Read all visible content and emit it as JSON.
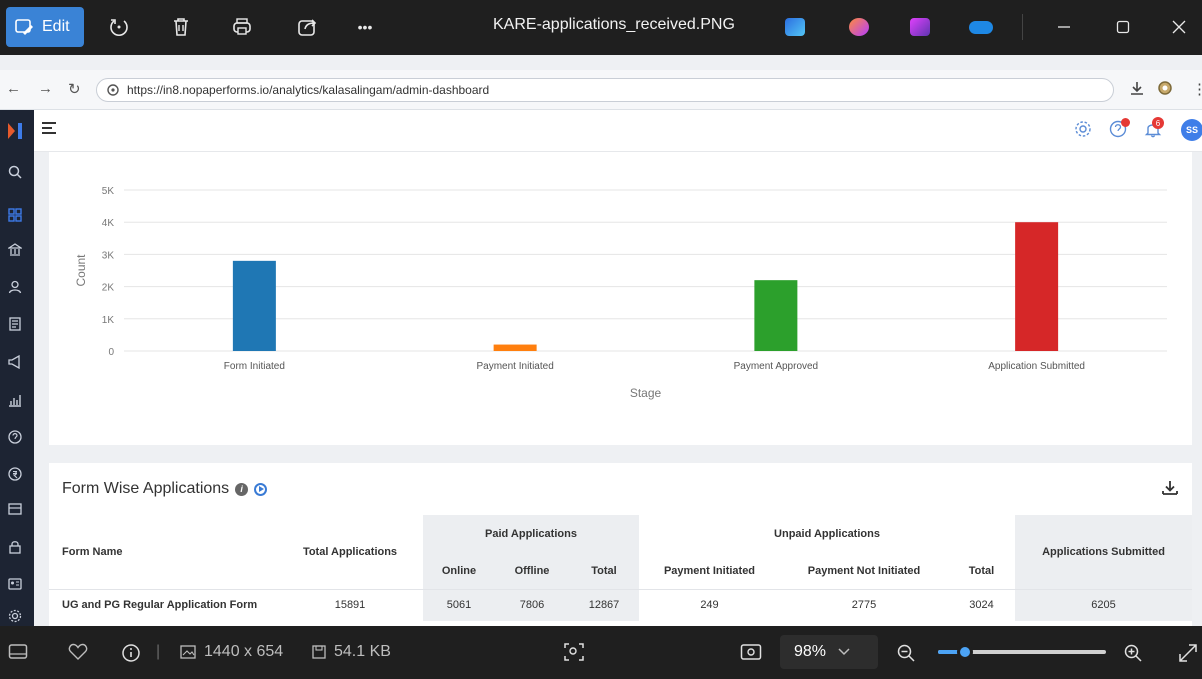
{
  "viewer": {
    "edit_label": "Edit",
    "title": "KARE-applications_received.PNG",
    "more_label": "•••",
    "dimensions": "1440 x 654",
    "file_size": "54.1 KB",
    "zoom_level": "98%",
    "zoom_fraction": 0.16
  },
  "browser": {
    "url": "https://in8.nopaperforms.io/analytics/kalasalingam/admin-dashboard"
  },
  "header": {
    "notification_count": "6",
    "avatar_initials": "SS"
  },
  "chart_data": {
    "type": "bar",
    "categories": [
      "Form Initiated",
      "Payment Initiated",
      "Payment Approved",
      "Application Submitted"
    ],
    "values": [
      2800,
      200,
      2200,
      4000
    ],
    "colors": [
      "#1f77b4",
      "#ff7f0e",
      "#2ca02c",
      "#d62728"
    ],
    "xlabel": "Stage",
    "ylabel": "Count",
    "yticks": [
      "0",
      "1K",
      "2K",
      "3K",
      "4K",
      "5K"
    ],
    "ylim": [
      0,
      5000
    ],
    "grid": true
  },
  "form_wise": {
    "title": "Form Wise Applications",
    "headers": {
      "form_name": "Form Name",
      "total_applications": "Total Applications",
      "paid_group": "Paid Applications",
      "unpaid_group": "Unpaid Applications",
      "applications_submitted": "Applications Submitted",
      "online": "Online",
      "offline": "Offline",
      "paid_total": "Total",
      "payment_initiated": "Payment Initiated",
      "payment_not_initiated": "Payment Not Initiated",
      "unpaid_total": "Total"
    },
    "rows": [
      {
        "form_name": "UG and PG Regular Application Form",
        "total_applications": "15891",
        "online": "5061",
        "offline": "7806",
        "paid_total": "12867",
        "payment_initiated": "249",
        "payment_not_initiated": "2775",
        "unpaid_total": "3024",
        "applications_submitted": "6205"
      }
    ]
  }
}
